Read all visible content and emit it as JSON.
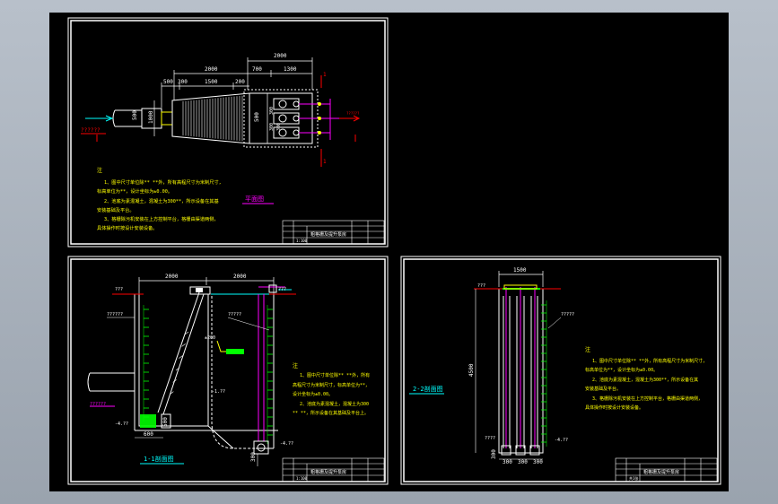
{
  "colors": {
    "background": "#000000",
    "frame": "#ffffff",
    "dimension": "#ffffff",
    "structure": "#00ffff",
    "magenta": "#ff00ff",
    "red": "#ff0000",
    "yellow": "#ffff00",
    "green": "#00ff00"
  },
  "plan": {
    "dims_top": [
      "2000"
    ],
    "dims_mid": [
      "2000",
      "700",
      "1300"
    ],
    "dims_low": [
      "500",
      "300",
      "1500",
      "200"
    ],
    "dims_vertical": [
      "500",
      "1000",
      "500",
      "300",
      "300",
      "300"
    ],
    "pipe_label": "??????",
    "marker": "1",
    "title": "平面图",
    "notes_head": "注",
    "notes": [
      "1、图中尺寸单位除** **外，所有高程尺寸为米制尺寸,",
      "标高单位为**，设计坐标为±0.00。",
      "2、池底为素混凝土，混凝土为300**，所示设备在其基",
      "安装基础及平台。",
      "3、格栅除污机安装在上方控制平台，格栅由渠道两侧，",
      "具体操作时按设计安装设备。"
    ]
  },
  "section11": {
    "dims_top": [
      "2000",
      "2000"
    ],
    "levels_left": [
      "???",
      "???"
    ],
    "level_labels": [
      "??????",
      "??????"
    ],
    "right_labels": [
      "?????"
    ],
    "level_values": [
      "-1.??",
      "-4.??",
      "-4.??"
    ],
    "bottom_dims": [
      "600",
      "300"
    ],
    "title": "1-1剖面图",
    "notes_head": "注",
    "notes": [
      "1、图中尺寸单位除** **外，所有",
      "高程尺寸为米制尺寸，标高单位为**，",
      "设计坐标为±0.00。",
      "2、池底为素混凝土，混凝土为300",
      "** **，所示设备在其基础及平台上。"
    ]
  },
  "section22": {
    "dim_top": "1500",
    "dim_height": "4500",
    "level_label": "????",
    "bottom_dims": [
      "300",
      "300",
      "300"
    ],
    "title": "2-2剖面图",
    "notes_head": "注",
    "notes": [
      "1、图中尺寸单位除** **外，所有高程尺寸为米制尺寸，",
      "标高单位为**，设计坐标为±0.00。",
      "2、池底为素混凝土，混凝土为300**，所示设备在其",
      "安装基础及平台。",
      "3、格栅除污机安装在上方控制平台，格栅由渠道两侧，",
      "具体操作时按设计安装设备。"
    ]
  },
  "title_block": {
    "drawing_name": "粗格栅及提升泵房",
    "scale": "1:100",
    "sheet": "共1张"
  }
}
